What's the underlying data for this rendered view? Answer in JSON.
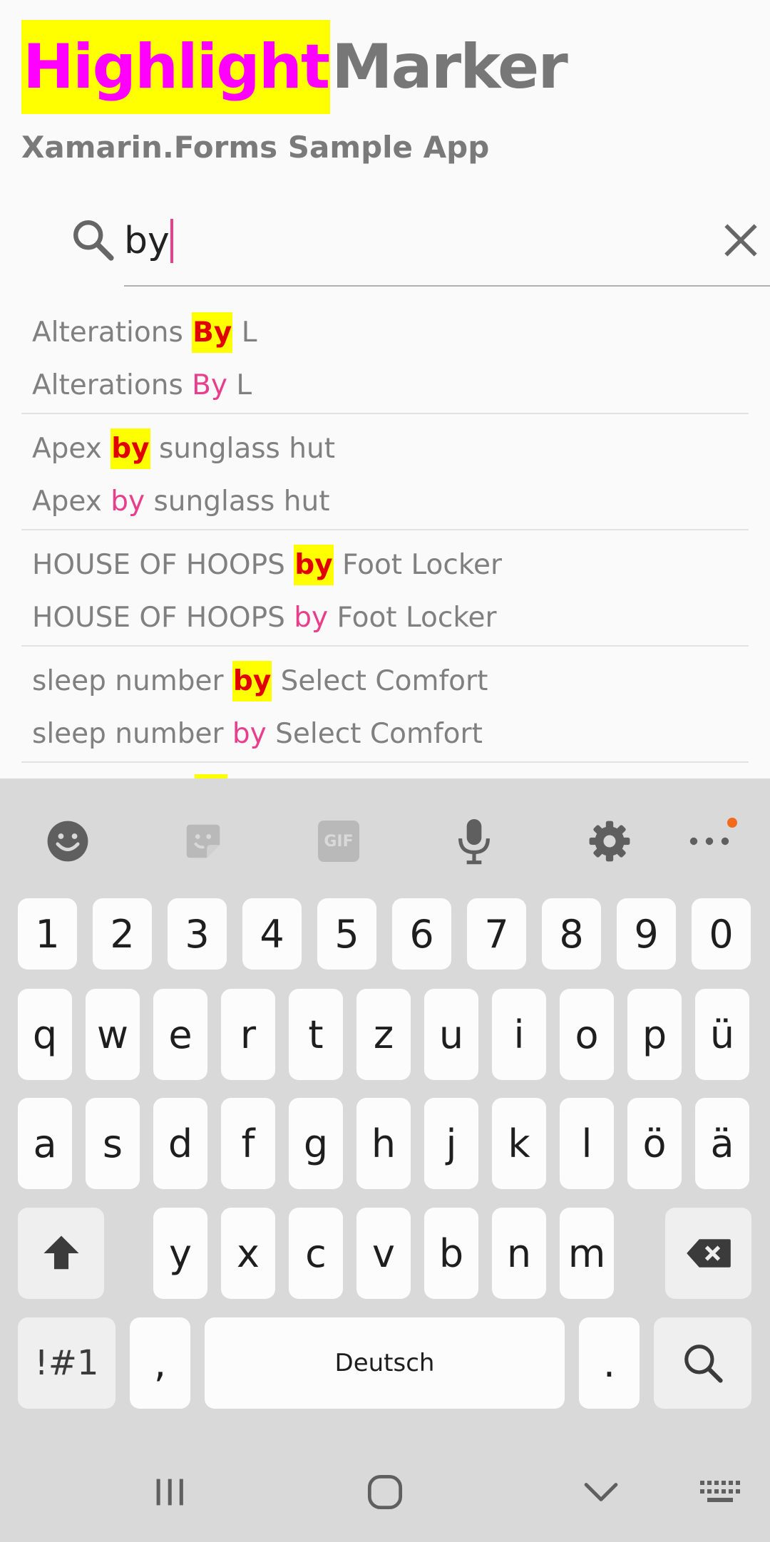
{
  "app": {
    "title_highlight": "Highlight",
    "title_rest": "Marker",
    "subtitle": "Xamarin.Forms Sample App"
  },
  "search": {
    "value": "by"
  },
  "results": [
    {
      "l1_before": "Alterations ",
      "l1_match": "By",
      "l1_after": " L",
      "l2_before": "Alterations ",
      "l2_match": "By",
      "l2_after": " L"
    },
    {
      "l1_before": "Apex ",
      "l1_match": "by",
      "l1_after": " sunglass hut",
      "l2_before": "Apex ",
      "l2_match": "by",
      "l2_after": " sunglass hut"
    },
    {
      "l1_before": "HOUSE OF HOOPS ",
      "l1_match": "by",
      "l1_after": " Foot Locker",
      "l2_before": "HOUSE OF HOOPS ",
      "l2_match": "by",
      "l2_after": " Foot Locker"
    },
    {
      "l1_before": "sleep number ",
      "l1_match": "by",
      "l1_after": " Select Comfort",
      "l2_before": "sleep number ",
      "l2_match": "by",
      "l2_after": " Select Comfort"
    }
  ],
  "keyboard": {
    "numbers": [
      "1",
      "2",
      "3",
      "4",
      "5",
      "6",
      "7",
      "8",
      "9",
      "0"
    ],
    "row1": [
      "q",
      "w",
      "e",
      "r",
      "t",
      "z",
      "u",
      "i",
      "o",
      "p",
      "ü"
    ],
    "row2": [
      "a",
      "s",
      "d",
      "f",
      "g",
      "h",
      "j",
      "k",
      "l",
      "ö",
      "ä"
    ],
    "row3": [
      "y",
      "x",
      "c",
      "v",
      "b",
      "n",
      "m"
    ],
    "symbols_label": "!#1",
    "comma_label": ",",
    "space_label": "Deutsch",
    "period_label": ".",
    "gif_label": "GIF"
  },
  "colors": {
    "highlight_bg": "#ffff00",
    "title_highlight_text": "#ff00ff",
    "match_bold": "#e00000",
    "match_pink": "#e83e8c",
    "notification_dot": "#f26b1d"
  }
}
